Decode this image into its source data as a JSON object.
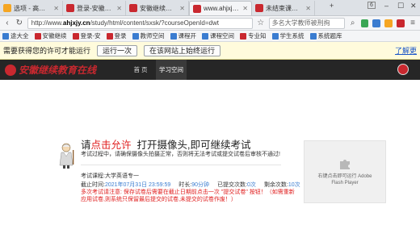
{
  "tabs": [
    {
      "label": "选项 - 高级设置",
      "color": "#f5a623",
      "active": false
    },
    {
      "label": "登录-安徽继续教",
      "color": "#c9282f",
      "active": false
    },
    {
      "label": "安徽继续教育在线",
      "color": "#c9282f",
      "active": false
    },
    {
      "label": "www.ahjxjy.cn/",
      "color": "#c9282f",
      "active": true
    },
    {
      "label": "未结束课程 - 安",
      "color": "#c9282f",
      "active": false
    }
  ],
  "window": {
    "tab_count": "6"
  },
  "address": {
    "scheme": "http://www.",
    "host": "ahjxjy.cn",
    "path": "/study/html/content/sxsk/?courseOpenId=dwt",
    "search_placeholder": "多名大学教师被刑拘"
  },
  "bookmarks": [
    {
      "label": "途大全",
      "color": "#3a7cd0"
    },
    {
      "label": "安徽继续",
      "color": "#c9282f"
    },
    {
      "label": "登录-安",
      "color": "#c9282f"
    },
    {
      "label": "登录",
      "color": "#c9282f"
    },
    {
      "label": "教师空间",
      "color": "#3a7cd0"
    },
    {
      "label": "课程开",
      "color": "#3a7cd0"
    },
    {
      "label": "课程空间",
      "color": "#3a7cd0"
    },
    {
      "label": "专业知",
      "color": "#c9282f"
    },
    {
      "label": "学生系统",
      "color": "#3a7cd0"
    },
    {
      "label": "系统题库",
      "color": "#3a7cd0"
    }
  ],
  "infobar": {
    "message": "需要获得您的许可才能运行",
    "run_once": "运行一次",
    "always_run": "在该网站上始终运行",
    "learn_more": "了解更"
  },
  "site": {
    "logo_text": "安徽继续教育在线",
    "nav": [
      {
        "label": "首 页",
        "active": false
      },
      {
        "label": "学习空间",
        "active": true
      }
    ]
  },
  "camera": {
    "title_prefix": "请",
    "title_highlight": "点击允许",
    "title_suffix": "打开摄像头,即可继续考试",
    "description": "考试过程中，请确保摄像头拍摄正常，否则将无法考试或提交试卷后审核不通过!",
    "course_label": "考试课程:",
    "course_name": "大学英语专一",
    "deadline_label": "截止时间:",
    "deadline_value": "2021年07月31日 23:59:59",
    "duration_label": "时长:",
    "duration_value": "90分钟",
    "submitted_label": "已提交次数:",
    "submitted_value": "0次",
    "remaining_label": "剩余次数:",
    "remaining_value": "10次",
    "warn_label": "多次考试请注意:",
    "warn_text": "保存试卷后需要在截止日期前点击一次 \"提交试卷\" 按钮！（如需重新应用试卷,则系统只保留最后提交的试卷,未提交的试卷作废！）"
  },
  "flash": {
    "message": "右键点击即可运行 Adobe Flash Player"
  },
  "colors": {
    "brand_red": "#c9282f",
    "header_bg": "#262626",
    "infobar_bg": "#fffbdc",
    "warn_red": "#e02020"
  }
}
